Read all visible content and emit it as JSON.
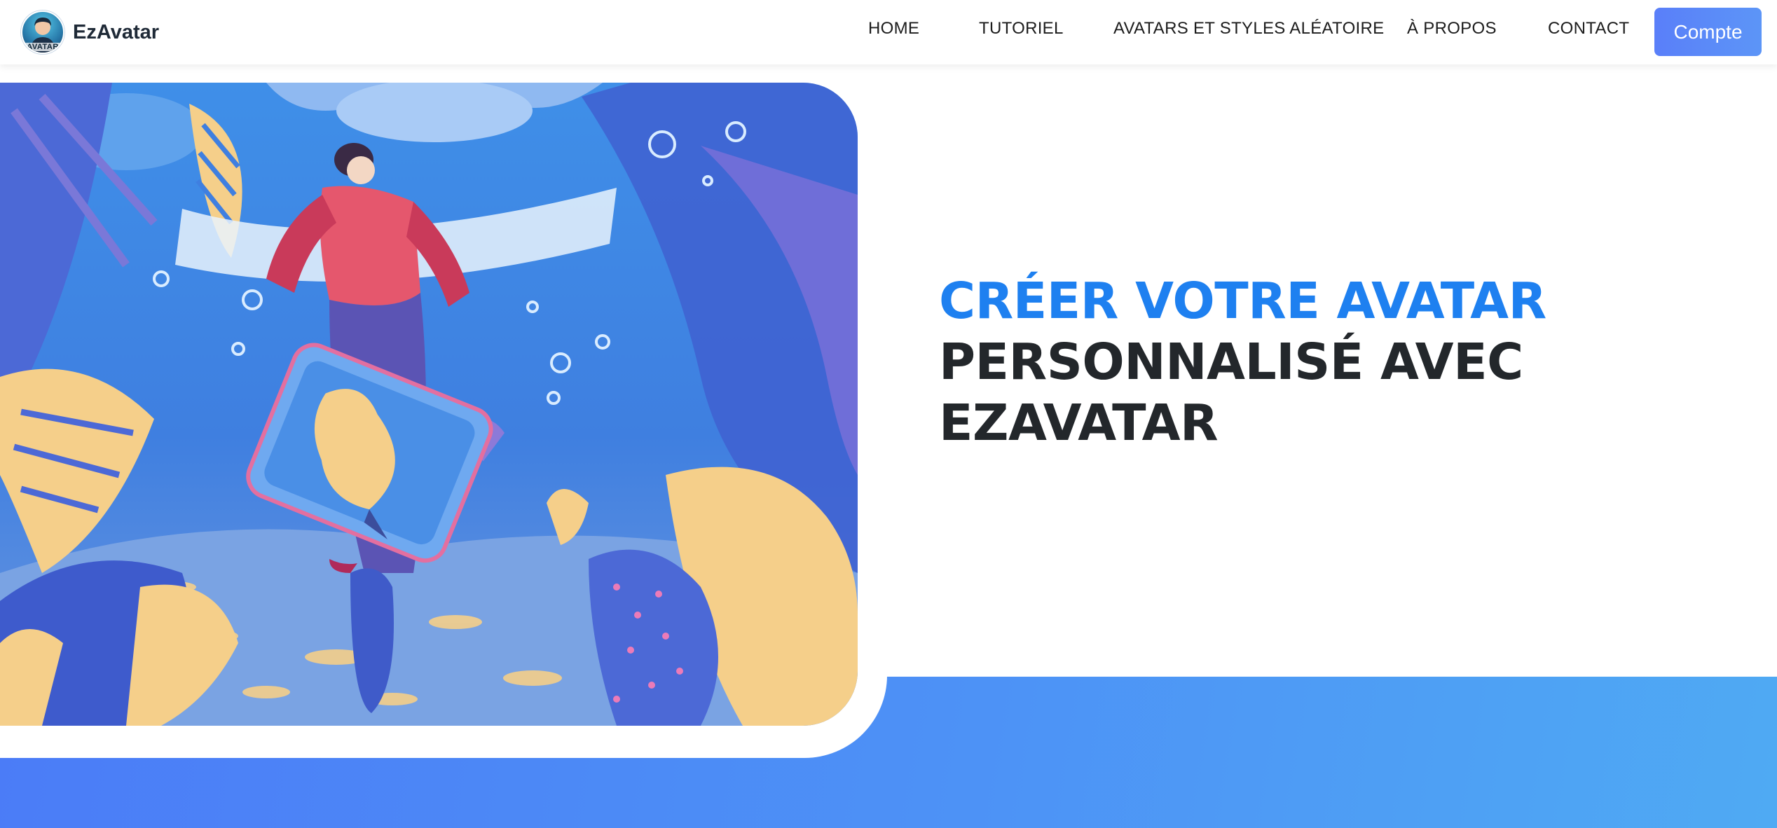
{
  "brand": {
    "name": "EzAvatar",
    "logo_text": "AVATAR",
    "logo_icon": "avatar-logo-icon"
  },
  "nav": {
    "items": [
      {
        "label": "HOME"
      },
      {
        "label": "TUTORIEL"
      },
      {
        "label": "AVATARS ET STYLES ALÉATOIRE"
      },
      {
        "label": "À PROPOS"
      },
      {
        "label": "CONTACT"
      }
    ],
    "account_button": "Compte"
  },
  "hero": {
    "headline_accent": "CRÉER VOTRE AVATAR",
    "headline_line2": "PERSONNALISÉ AVEC",
    "headline_line3": "EZAVATAR",
    "image_subject": "underwater-illustration-person-holding-phone-with-fish"
  },
  "colors": {
    "accent": "#1e80f0",
    "button": "#5a7ff9",
    "band_start": "#4b7cf7",
    "band_end": "#4faaf3",
    "text_dark": "#23272b"
  }
}
